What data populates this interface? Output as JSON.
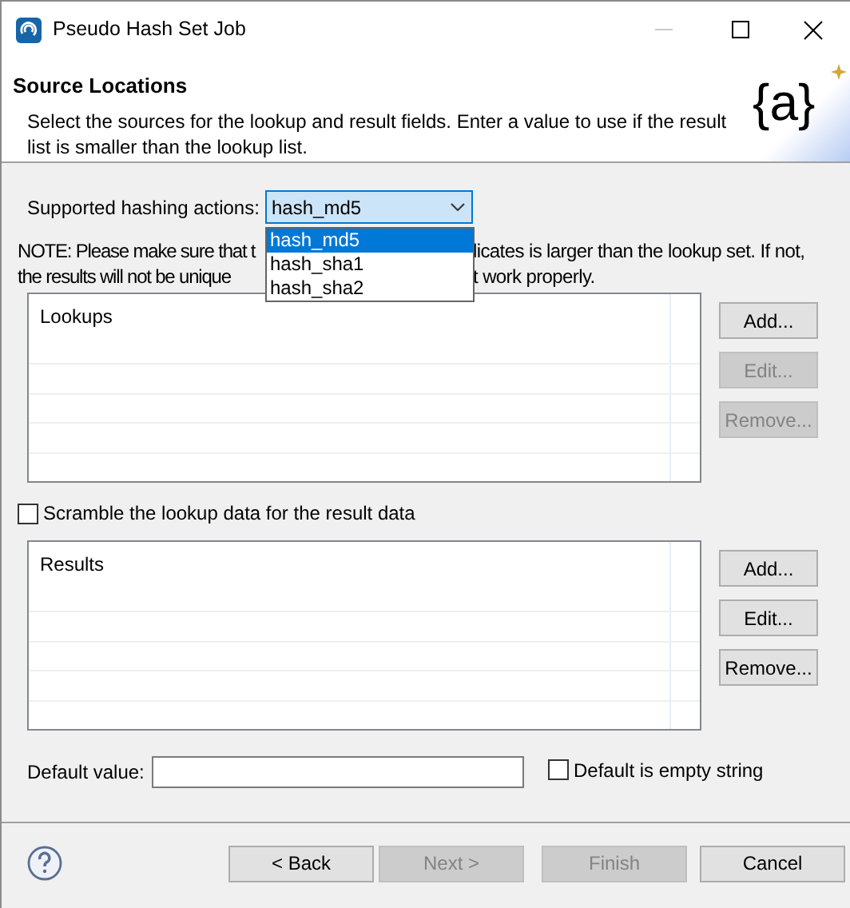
{
  "window": {
    "title": "Pseudo Hash Set Job"
  },
  "header": {
    "title": "Source Locations",
    "description": "Select the sources for the lookup and result fields. Enter a value to use if the result list is smaller than the lookup list.",
    "logo_text": "{a}"
  },
  "hashing": {
    "label": "Supported hashing actions:",
    "value": "hash_md5",
    "expanded": true,
    "options": [
      {
        "label": "hash_md5",
        "selected": true
      },
      {
        "label": "hash_sha1",
        "selected": false
      },
      {
        "label": "hash_sha2",
        "selected": false
      }
    ]
  },
  "note": {
    "line_1": [
      "NOTE: Please make sure that t",
      "licates is larger than the lookup set. If not,"
    ],
    "line_2": [
      "the results will not be unique",
      "t work properly."
    ]
  },
  "lookups": {
    "header": "Lookups",
    "buttons": [
      {
        "label": "Add...",
        "disabled": false
      },
      {
        "label": "Edit...",
        "disabled": true
      },
      {
        "label": "Remove...",
        "disabled": true
      }
    ]
  },
  "scramble": {
    "label": "Scramble the lookup data for the result data",
    "checked": false
  },
  "results": {
    "header": "Results",
    "buttons": [
      {
        "label": "Add...",
        "disabled": false
      },
      {
        "label": "Edit...",
        "disabled": false
      },
      {
        "label": "Remove...",
        "disabled": false
      }
    ]
  },
  "default_value": {
    "label": "Default value:"
  },
  "empty_string": {
    "label": "Default is empty string",
    "checked": false
  },
  "footer_buttons": [
    {
      "label": "< Back",
      "disabled": false
    },
    {
      "label": "Next >",
      "disabled": true
    },
    {
      "label": "Finish",
      "disabled": true
    },
    {
      "label": "Cancel",
      "disabled": false
    }
  ]
}
